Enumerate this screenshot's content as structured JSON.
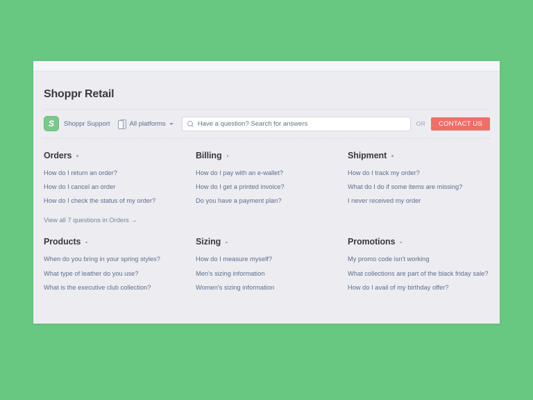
{
  "window": {
    "background_color": "#68c781",
    "card_color": "#edecf1",
    "chrome_color": "#f4f5f8"
  },
  "header": {
    "site_title": "Shoppr Retail"
  },
  "toolbar": {
    "logo_letter": "S",
    "logo_color": "#79c98e",
    "brand_name": "Shoppr Support",
    "platform_label": "All platforms",
    "search_placeholder": "Have a question? Search for answers",
    "search_value": "",
    "or_label": "OR",
    "contact_label": "CONTACT US",
    "contact_color": "#ef6f66"
  },
  "faq": {
    "columns": [
      {
        "title": "Orders",
        "links": [
          "How do I return an order?",
          "How do I cancel an order",
          "How do I check the status of my order?"
        ],
        "view_all": "View all 7 questions in Orders →"
      },
      {
        "title": "Billing",
        "links": [
          "How do I pay with an e-wallet?",
          "How do I get a printed invoice?",
          "Do you have a payment plan?"
        ],
        "view_all": ""
      },
      {
        "title": "Shipment",
        "links": [
          "How do I track my order?",
          "What do I do if some items are missing?",
          "I never received my order"
        ],
        "view_all": ""
      },
      {
        "title": "Products",
        "links": [
          "When do you bring in your spring styles?",
          "What type of leather do you use?",
          "What is the executive club collection?"
        ],
        "view_all": ""
      },
      {
        "title": "Sizing",
        "links": [
          "How do I measure myself?",
          "Men's sizing information",
          "Women's sizing information"
        ],
        "view_all": ""
      },
      {
        "title": "Promotions",
        "links": [
          "My promo code isn't working",
          "What collections are part of the black friday sale?",
          "How do I avail of my birthday offer?"
        ],
        "view_all": ""
      }
    ]
  }
}
